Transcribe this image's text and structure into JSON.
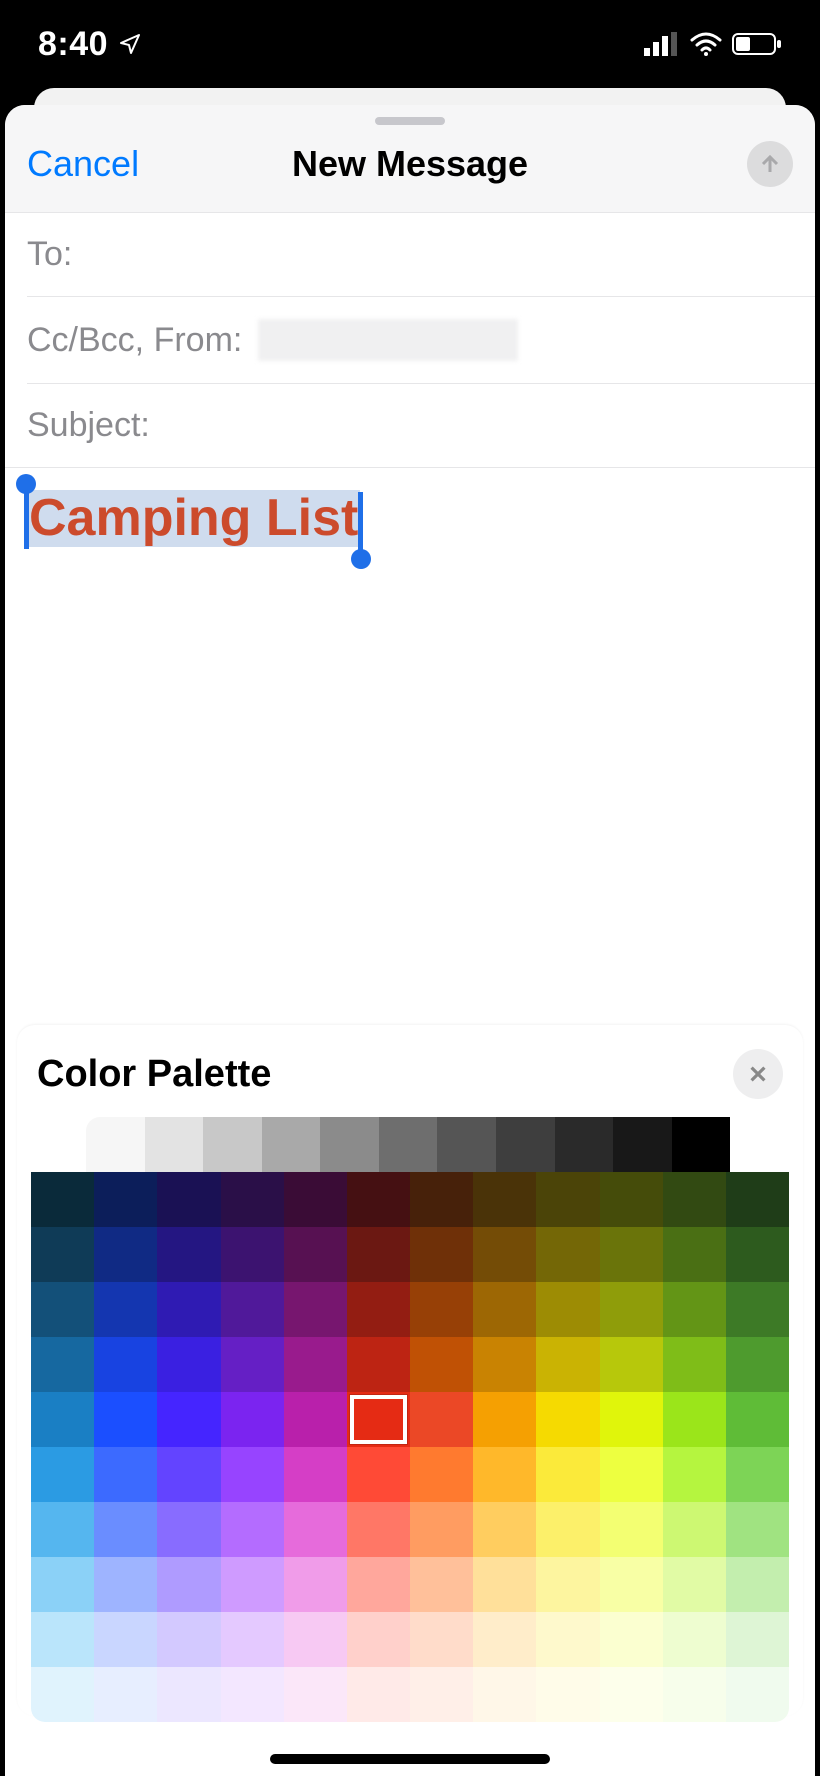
{
  "status_bar": {
    "time": "8:40",
    "location_icon": "location-arrow-icon",
    "signal_icon": "cell-signal-icon",
    "wifi_icon": "wifi-icon",
    "battery_icon": "battery-icon"
  },
  "compose": {
    "cancel_label": "Cancel",
    "title": "New Message",
    "send_icon": "arrow-up-icon",
    "fields": {
      "to_label": "To:",
      "cc_from_label": "Cc/Bcc, From:",
      "subject_label": "Subject:"
    },
    "body": {
      "selected_text": "Camping List",
      "selected_text_color": "#cc4b2c"
    }
  },
  "palette_panel": {
    "title": "Color Palette",
    "close_icon": "close-icon",
    "selected_color": "#eb4826",
    "selected_index": {
      "row": 4,
      "col": 5
    },
    "grays": [
      "#f6f6f6",
      "#e3e3e3",
      "#c8c8c8",
      "#a9a9a9",
      "#8b8b8b",
      "#6e6e6e",
      "#555555",
      "#3e3e3e",
      "#2a2a2a",
      "#181818",
      "#000000"
    ],
    "colors": [
      [
        "#0a2a3a",
        "#0c1e5a",
        "#1a1154",
        "#2a0f48",
        "#3a0c36",
        "#451012",
        "#47210a",
        "#4a3308",
        "#4b4408",
        "#454c0a",
        "#324a12",
        "#1f3d18"
      ],
      [
        "#0f3b57",
        "#102a84",
        "#241682",
        "#3c1370",
        "#571152",
        "#6b1812",
        "#6f3008",
        "#744c06",
        "#746706",
        "#6a740a",
        "#4a6f14",
        "#2d5b1e"
      ],
      [
        "#135079",
        "#1436b0",
        "#2f1bb3",
        "#50199a",
        "#77166f",
        "#931d12",
        "#974006",
        "#9d6704",
        "#9d8c04",
        "#8f9d0a",
        "#639516",
        "#3d7a26"
      ],
      [
        "#1668a0",
        "#1843e1",
        "#3a20e1",
        "#651fc5",
        "#991b8d",
        "#bd2413",
        "#c05105",
        "#c98302",
        "#cab303",
        "#b7c80b",
        "#7fbd18",
        "#4e9b2e"
      ],
      [
        "#1a7fc4",
        "#1b4fff",
        "#4525ff",
        "#7b24f0",
        "#b920ab",
        "#e52b14",
        "#eb4826",
        "#f5a002",
        "#f5da01",
        "#e0f50b",
        "#9be51a",
        "#5fbc37"
      ],
      [
        "#2b9be3",
        "#3c6aff",
        "#6344ff",
        "#9744ff",
        "#d53ec6",
        "#ff4a36",
        "#ff7a2f",
        "#ffb82a",
        "#fbea3a",
        "#edff40",
        "#b5f53f",
        "#7dd456"
      ],
      [
        "#55b6ef",
        "#6a8dff",
        "#886cff",
        "#b46cff",
        "#e66bdb",
        "#ff7766",
        "#ff9c61",
        "#ffcd5f",
        "#fcf06a",
        "#f3ff72",
        "#cdf872",
        "#a0e381"
      ],
      [
        "#8bd1f7",
        "#9eb4ff",
        "#af9bff",
        "#cf9bff",
        "#f09ce9",
        "#ffa79c",
        "#ffc09a",
        "#ffe09a",
        "#fdf59f",
        "#f8ffa5",
        "#e1fba5",
        "#c3eeae"
      ],
      [
        "#bae5fb",
        "#c9d6ff",
        "#d3c9ff",
        "#e4c9ff",
        "#f7c9f3",
        "#ffd0cb",
        "#ffdcca",
        "#ffedca",
        "#fef9cc",
        "#fbffd0",
        "#eefdd0",
        "#def5d5"
      ],
      [
        "#e0f3fd",
        "#e7eeff",
        "#ece7ff",
        "#f3e7ff",
        "#fbe7f9",
        "#ffeae8",
        "#ffefe8",
        "#fff7e8",
        "#fffce9",
        "#fdffeb",
        "#f7feeb",
        "#f0fbee"
      ]
    ]
  }
}
